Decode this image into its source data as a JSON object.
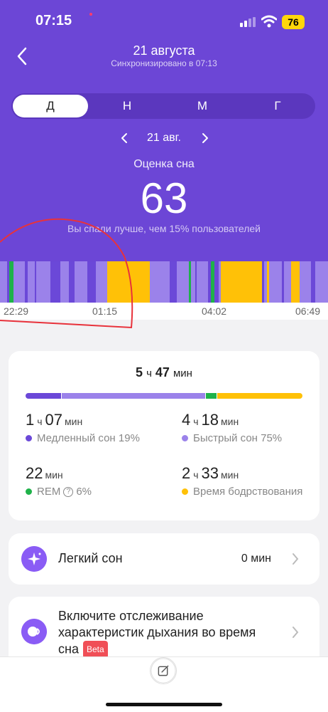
{
  "status_bar": {
    "time": "07:15",
    "battery": "76"
  },
  "header": {
    "title": "21 августа",
    "subtitle": "Синхронизировано в 07:13"
  },
  "period_tabs": [
    {
      "label": "Д",
      "active": true
    },
    {
      "label": "Н",
      "active": false
    },
    {
      "label": "М",
      "active": false
    },
    {
      "label": "Г",
      "active": false
    }
  ],
  "date_nav": {
    "label": "21 авг."
  },
  "score": {
    "label": "Оценка сна",
    "value": "63",
    "comparison": "Вы спали лучше, чем 15% пользователей"
  },
  "timeline": {
    "axis_labels": [
      "22:29",
      "01:15",
      "04:02",
      "06:49"
    ],
    "stage_colors": {
      "deep": "#6b48d8",
      "light": "#9b82ea",
      "rem": "#1fb24a",
      "awake": "#ffc107"
    }
  },
  "summary": {
    "total_h": "5",
    "total_h_unit": "ч",
    "total_m": "47",
    "total_m_unit": "мин",
    "stats": [
      {
        "h": "1",
        "h_unit": "ч",
        "m": "07",
        "m_unit": "мин",
        "label": "Медленный сон 19%",
        "color": "#6b48d8"
      },
      {
        "h": "4",
        "h_unit": "ч",
        "m": "18",
        "m_unit": "мин",
        "label": "Быстрый сон 75%",
        "color": "#9b82ea"
      },
      {
        "m": "22",
        "m_unit": "мин",
        "label": "REM",
        "extra": "6%",
        "color": "#1fb24a"
      },
      {
        "h": "2",
        "h_unit": "ч",
        "m": "33",
        "m_unit": "мин",
        "label": "Время бодрствования",
        "color": "#ffc107"
      }
    ]
  },
  "cards": {
    "light_sleep": {
      "title": "Легкий сон",
      "value": "0 мин"
    },
    "breathing": {
      "title": "Включите отслеживание характеристик дыхания во время сна",
      "badge": "Beta"
    }
  }
}
